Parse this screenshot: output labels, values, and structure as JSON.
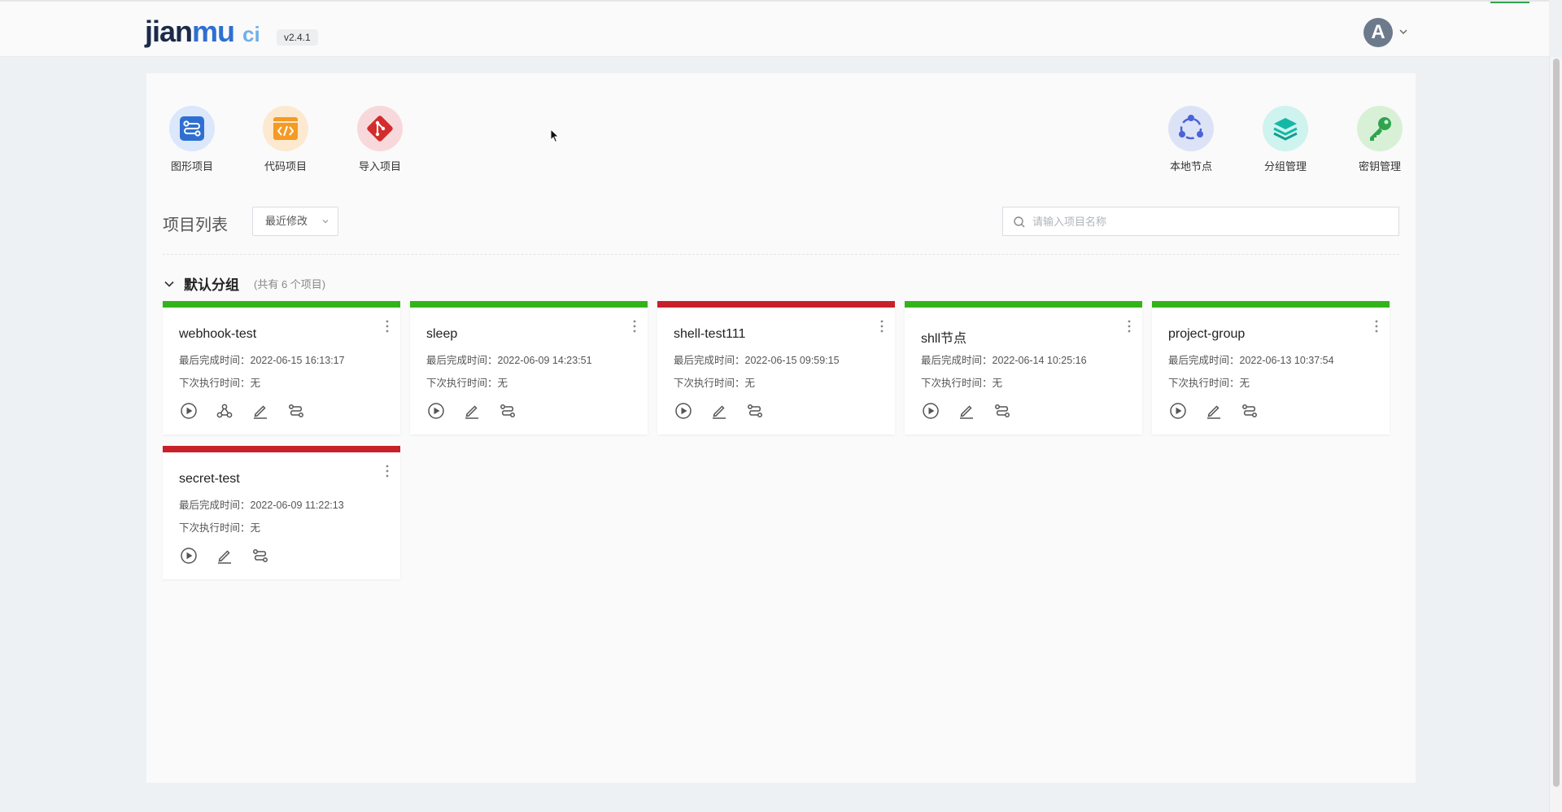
{
  "header": {
    "logo": {
      "jian": "jian",
      "mu": "mu",
      "ci": "ci"
    },
    "version": "v2.4.1",
    "avatar_letter": "A"
  },
  "quick_actions_left": [
    {
      "label": "图形项目",
      "icon": "workflow-icon",
      "color": "#2f6fd1"
    },
    {
      "label": "代码项目",
      "icon": "code-icon",
      "color": "#f59a23"
    },
    {
      "label": "导入项目",
      "icon": "git-icon",
      "color": "#d42c2c"
    }
  ],
  "quick_actions_right": [
    {
      "label": "本地节点",
      "icon": "nodes-icon",
      "color": "#4a63d8"
    },
    {
      "label": "分组管理",
      "icon": "layers-icon",
      "color": "#14b8a6"
    },
    {
      "label": "密钥管理",
      "icon": "key-icon",
      "color": "#2fa44f"
    }
  ],
  "project_list": {
    "title": "项目列表",
    "sort_label": "最近修改",
    "search_placeholder": "请输入项目名称"
  },
  "group": {
    "name": "默认分组",
    "count_text": "(共有 6 个项目)"
  },
  "labels": {
    "last_finish": "最后完成时间：",
    "next_exec": "下次执行时间："
  },
  "projects": [
    {
      "name": "webhook-test",
      "status": "success",
      "last_finish": "2022-06-15 16:13:17",
      "next_exec": "无",
      "has_webhook": true
    },
    {
      "name": "sleep",
      "status": "success",
      "last_finish": "2022-06-09 14:23:51",
      "next_exec": "无",
      "has_webhook": false
    },
    {
      "name": "shell-test111",
      "status": "fail",
      "last_finish": "2022-06-15 09:59:15",
      "next_exec": "无",
      "has_webhook": false
    },
    {
      "name": "shll节点",
      "status": "success",
      "last_finish": "2022-06-14 10:25:16",
      "next_exec": "无",
      "has_webhook": false
    },
    {
      "name": "project-group",
      "status": "success",
      "last_finish": "2022-06-13 10:37:54",
      "next_exec": "无",
      "has_webhook": false
    },
    {
      "name": "secret-test",
      "status": "fail",
      "last_finish": "2022-06-09 11:22:13",
      "next_exec": "无",
      "has_webhook": false
    }
  ]
}
